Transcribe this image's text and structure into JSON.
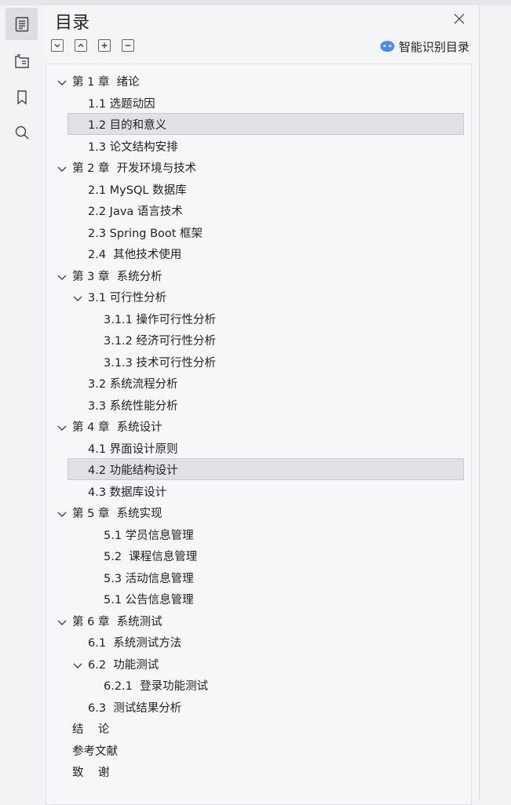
{
  "panel": {
    "title": "目录",
    "ai_detect_label": "智能识别目录",
    "tools": [
      "expand-all-icon",
      "collapse-all-icon",
      "add-entry-icon",
      "remove-entry-icon"
    ]
  },
  "sidebar": {
    "items": [
      {
        "icon": "toc-icon",
        "active": true
      },
      {
        "icon": "attachment-tab-icon",
        "active": false
      },
      {
        "icon": "bookmark-icon",
        "active": false
      },
      {
        "icon": "search-icon",
        "active": false
      }
    ]
  },
  "toc": [
    {
      "label": "第 1 章  绪论",
      "level": 1,
      "expandable": true
    },
    {
      "label": "1.1 选题动因",
      "level": 2
    },
    {
      "label": "1.2 目的和意义",
      "level": 2,
      "selected": true
    },
    {
      "label": "1.3 论文结构安排",
      "level": 2
    },
    {
      "label": "第 2 章  开发环境与技术",
      "level": 1,
      "expandable": true
    },
    {
      "label": "2.1 MySQL 数据库",
      "level": 2
    },
    {
      "label": "2.2 Java 语言技术",
      "level": 2
    },
    {
      "label": "2.3 Spring Boot 框架",
      "level": 2
    },
    {
      "label": "2.4  其他技术使用",
      "level": 2
    },
    {
      "label": "第 3 章  系统分析",
      "level": 1,
      "expandable": true
    },
    {
      "label": "3.1 可行性分析",
      "level": 2,
      "expandable": true
    },
    {
      "label": "3.1.1 操作可行性分析",
      "level": 3
    },
    {
      "label": "3.1.2 经济可行性分析",
      "level": 3
    },
    {
      "label": "3.1.3 技术可行性分析",
      "level": 3
    },
    {
      "label": "3.2 系统流程分析",
      "level": 2
    },
    {
      "label": "3.3 系统性能分析",
      "level": 2
    },
    {
      "label": "第 4 章  系统设计",
      "level": 1,
      "expandable": true
    },
    {
      "label": "4.1 界面设计原则",
      "level": 2
    },
    {
      "label": "4.2 功能结构设计",
      "level": 2,
      "selected": true
    },
    {
      "label": "4.3 数据库设计",
      "level": 2
    },
    {
      "label": "第 5 章  系统实现",
      "level": 1,
      "expandable": true
    },
    {
      "label": "5.1 学员信息管理",
      "level": 3
    },
    {
      "label": "5.2  课程信息管理",
      "level": 3
    },
    {
      "label": "5.3 活动信息管理",
      "level": 3
    },
    {
      "label": "5.1 公告信息管理",
      "level": 3
    },
    {
      "label": "第 6 章  系统测试",
      "level": 1,
      "expandable": true
    },
    {
      "label": "6.1  系统测试方法",
      "level": 2
    },
    {
      "label": "6.2  功能测试",
      "level": 2,
      "expandable": true
    },
    {
      "label": "6.2.1  登录功能测试",
      "level": 3
    },
    {
      "label": "6.3  测试结果分析",
      "level": 2
    },
    {
      "label": "结    论",
      "level": 1
    },
    {
      "label": "参考文献",
      "level": 1
    },
    {
      "label": "致    谢",
      "level": 1
    }
  ]
}
